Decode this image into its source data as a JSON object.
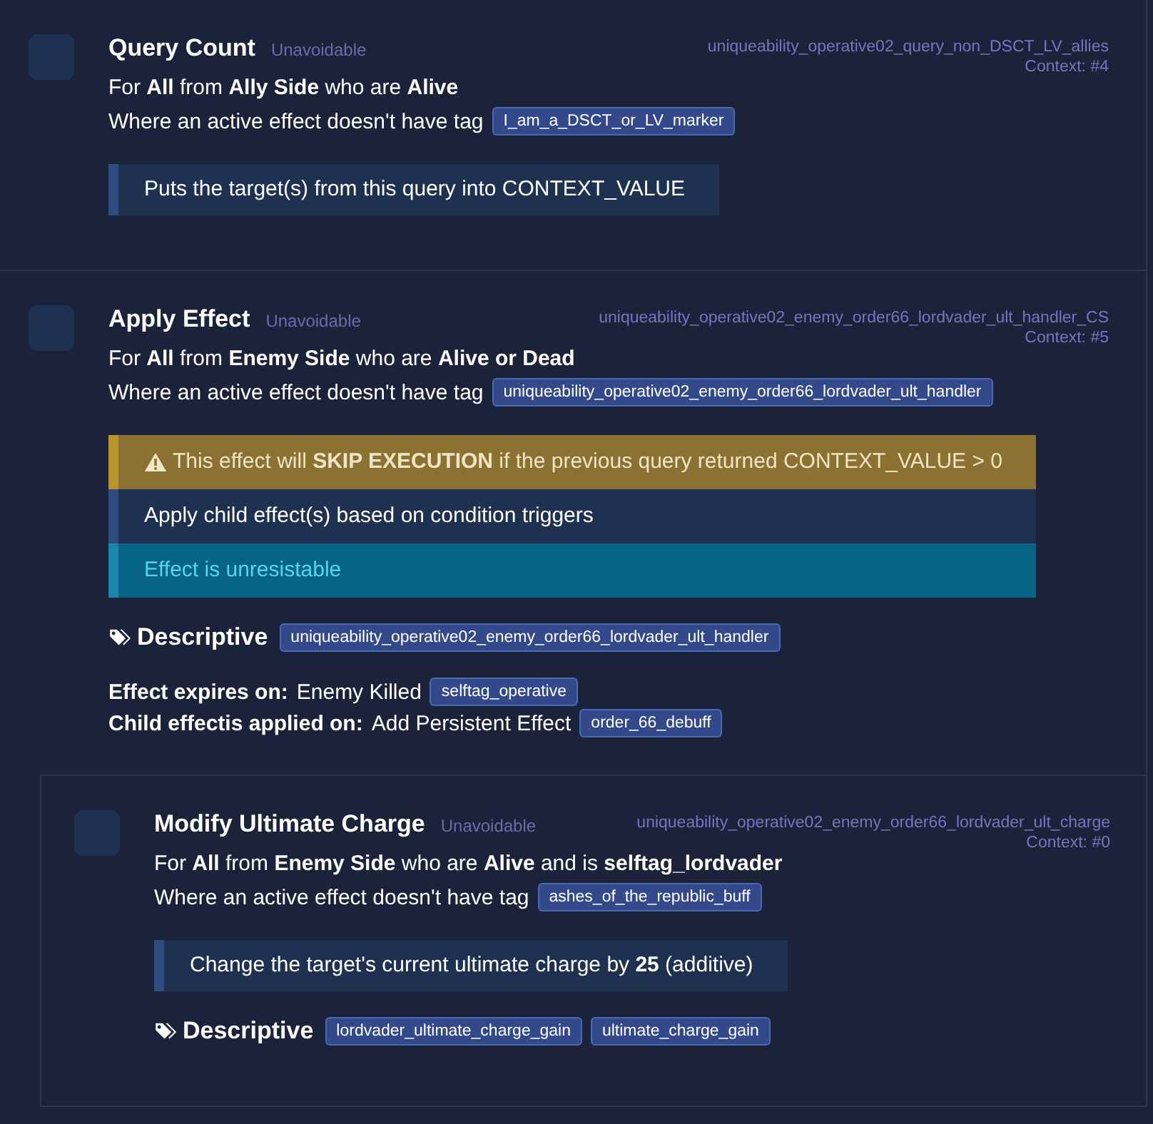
{
  "effects": [
    {
      "title": "Query Count",
      "flag": "Unavoidable",
      "identifier": "uniqueability_operative02_query_non_DSCT_LV_allies",
      "context": "Context: #4",
      "target": "For **All** from **Ally Side** who are **Alive**",
      "condition": {
        "text": "Where an active effect doesn't have tag",
        "tags": [
          "I_am_a_DSCT_or_LV_marker"
        ]
      },
      "notes": [
        {
          "kind": "info",
          "text": "Puts the target(s) from this query into CONTEXT_VALUE"
        }
      ]
    },
    {
      "title": "Apply Effect",
      "flag": "Unavoidable",
      "identifier": "uniqueability_operative02_enemy_order66_lordvader_ult_handler_CS",
      "context": "Context: #5",
      "target": "For **All** from **Enemy Side** who are **Alive or Dead**",
      "condition": {
        "text": "Where an active effect doesn't have tag",
        "tags": [
          "uniqueability_operative02_enemy_order66_lordvader_ult_handler"
        ]
      },
      "notes": [
        {
          "kind": "warning",
          "text": "This effect will **SKIP EXECUTION** if the previous query returned CONTEXT_VALUE > 0"
        },
        {
          "kind": "info",
          "text": "Apply child effect(s) based on condition triggers"
        },
        {
          "kind": "highlight",
          "text": "Effect is unresistable"
        }
      ],
      "descriptive": {
        "label": "Descriptive",
        "tags": [
          "uniqueability_operative02_enemy_order66_lordvader_ult_handler"
        ]
      },
      "triggers": [
        {
          "label": "Effect expires on:",
          "value": "Enemy Killed",
          "tag": "selftag_operative"
        },
        {
          "label": "Child effectis applied on:",
          "value": "Add Persistent Effect",
          "tag": "order_66_debuff"
        }
      ],
      "children": [
        {
          "title": "Modify Ultimate Charge",
          "flag": "Unavoidable",
          "identifier": "uniqueability_operative02_enemy_order66_lordvader_ult_charge",
          "context": "Context: #0",
          "target": "For **All** from **Enemy Side** who are **Alive** and is **selftag_lordvader**",
          "condition": {
            "text": "Where an active effect doesn't have tag",
            "tags": [
              "ashes_of_the_republic_buff"
            ]
          },
          "notes": [
            {
              "kind": "info",
              "text": "Change the target's current ultimate charge by **25** (additive)"
            }
          ],
          "descriptive": {
            "label": "Descriptive",
            "tags": [
              "lordvader_ultimate_charge_gain",
              "ultimate_charge_gain"
            ]
          }
        }
      ]
    }
  ]
}
